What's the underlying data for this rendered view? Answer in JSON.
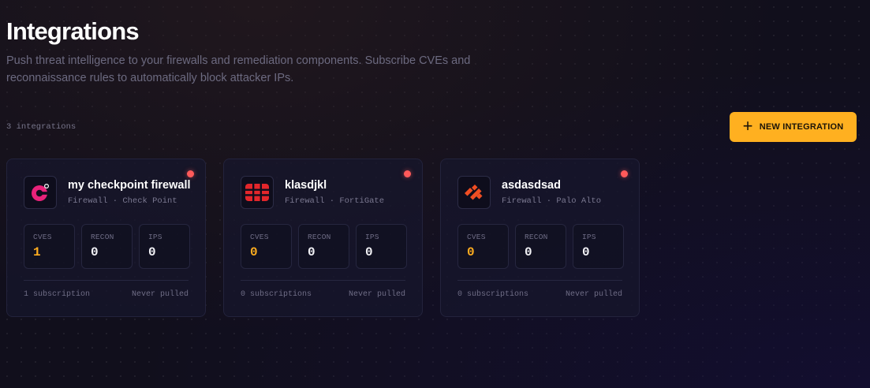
{
  "header": {
    "title": "Integrations",
    "subtitle": "Push threat intelligence to your firewalls and remediation components. Subscribe CVEs and reconnaissance rules to automatically block attacker IPs."
  },
  "toolbar": {
    "count_label": "3 integrations",
    "new_button_label": "NEW INTEGRATION",
    "new_button_icon": "plus-icon"
  },
  "colors": {
    "accent": "#ffb020",
    "status_dot": "#ff5a5a",
    "cve_value": "#ffad1f"
  },
  "integrations": [
    {
      "name": "my checkpoint firewall",
      "type": "Firewall",
      "vendor": "Check Point",
      "logo": "check-point-logo",
      "stats": {
        "cves_label": "CVES",
        "cves": "1",
        "recon_label": "RECON",
        "recon": "0",
        "ips_label": "IPS",
        "ips": "0"
      },
      "subscriptions": "1 subscription",
      "last_pulled": "Never pulled"
    },
    {
      "name": "klasdjkl",
      "type": "Firewall",
      "vendor": "FortiGate",
      "logo": "fortigate-logo",
      "stats": {
        "cves_label": "CVES",
        "cves": "0",
        "recon_label": "RECON",
        "recon": "0",
        "ips_label": "IPS",
        "ips": "0"
      },
      "subscriptions": "0 subscriptions",
      "last_pulled": "Never pulled"
    },
    {
      "name": "asdasdsad",
      "type": "Firewall",
      "vendor": "Palo Alto",
      "logo": "palo-alto-logo",
      "stats": {
        "cves_label": "CVES",
        "cves": "0",
        "recon_label": "RECON",
        "recon": "0",
        "ips_label": "IPS",
        "ips": "0"
      },
      "subscriptions": "0 subscriptions",
      "last_pulled": "Never pulled"
    }
  ]
}
